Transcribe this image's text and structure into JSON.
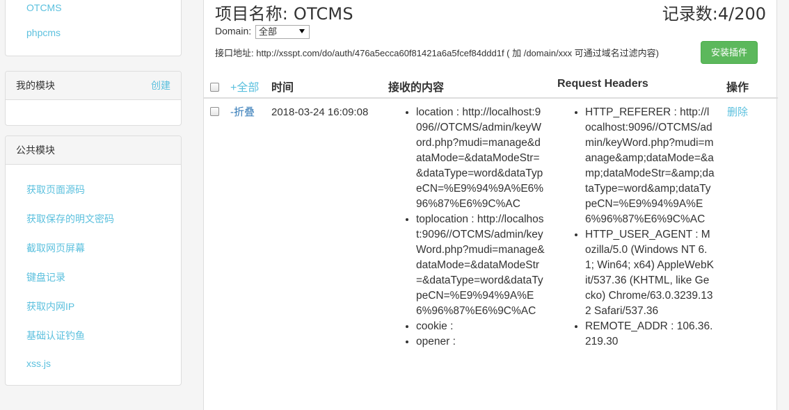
{
  "sidebar": {
    "top_links": [
      "OTCMS",
      "phpcms"
    ],
    "my_modules": {
      "title": "我的模块",
      "create_label": "创建"
    },
    "public_modules": {
      "title": "公共模块",
      "items": [
        "获取页面源码",
        "获取保存的明文密码",
        "截取网页屏幕",
        "键盘记录",
        "获取内网IP",
        "基础认证钓鱼",
        "xss.js"
      ]
    }
  },
  "header": {
    "title": "项目名称: OTCMS",
    "count": "记录数:4/200",
    "domain_label": "Domain:",
    "domain_value": "全部",
    "api_label": "接口地址: http://xsspt.com/do/auth/476a5ecca60f81421a6a5fcef84ddd1f ( 加 /domain/xxx 可通过域名过滤内容)",
    "install_button": "安装插件"
  },
  "table": {
    "headers": {
      "all": "+全部",
      "time": "时间",
      "content": "接收的内容",
      "request_headers": "Request Headers",
      "action": "操作"
    },
    "rows": [
      {
        "toggle": "-折叠",
        "time": "2018-03-24 16:09:08",
        "content": [
          "location : http://localhost:9096//OTCMS/admin/keyWord.php?mudi=manage&dataMode=&dataModeStr=&dataType=word&dataTypeCN=%E9%94%9A%E6%96%87%E6%9C%AC",
          "toplocation : http://localhost:9096//OTCMS/admin/keyWord.php?mudi=manage&dataMode=&dataModeStr=&dataType=word&dataTypeCN=%E9%94%9A%E6%96%87%E6%9C%AC",
          "cookie :",
          "opener :"
        ],
        "headers": [
          "HTTP_REFERER : http://localhost:9096//OTCMS/admin/keyWord.php?mudi=manage&amp;dataMode=&amp;dataModeStr=&amp;dataType=word&amp;dataTypeCN=%E9%94%9A%E6%96%87%E6%9C%AC",
          "HTTP_USER_AGENT : Mozilla/5.0 (Windows NT 6.1; Win64; x64) AppleWebKit/537.36 (KHTML, like Gecko) Chrome/63.0.3239.132 Safari/537.36",
          "REMOTE_ADDR : 106.36.219.30"
        ],
        "action": "删除"
      }
    ]
  }
}
